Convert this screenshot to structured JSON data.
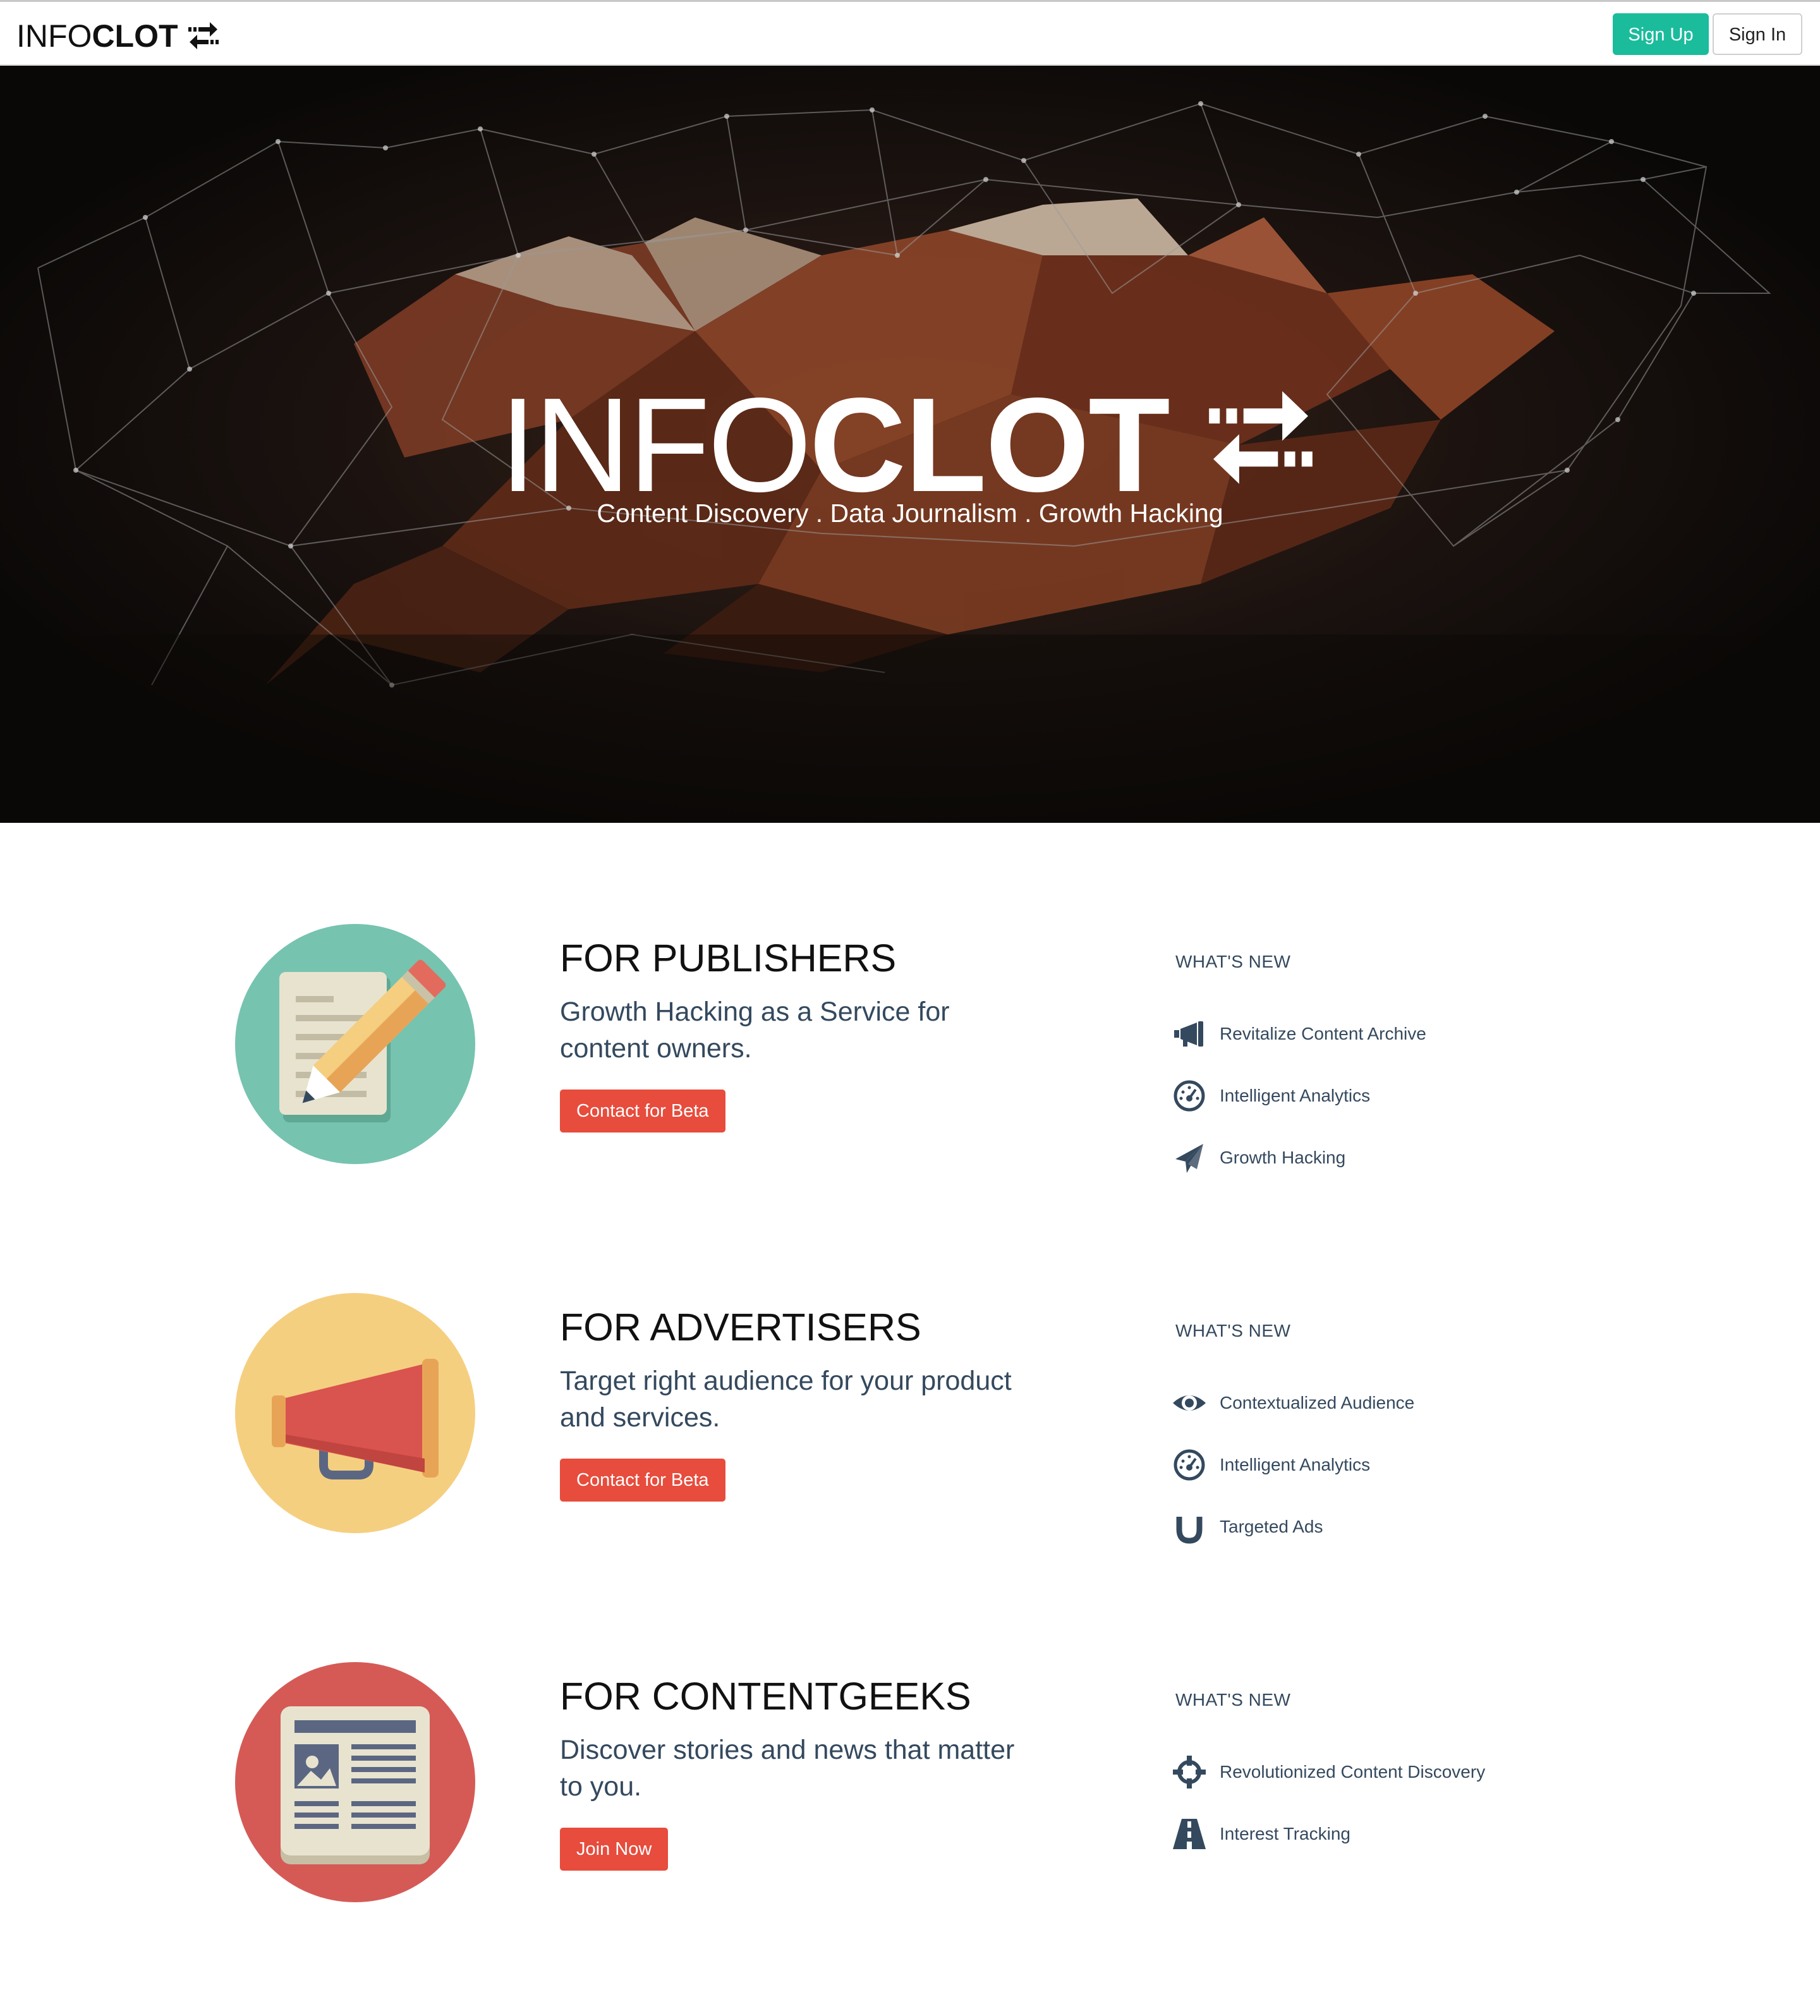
{
  "navbar": {
    "brand_light": "INFO",
    "brand_bold": "CLOT",
    "signup_label": "Sign Up",
    "signin_label": "Sign In"
  },
  "hero": {
    "title_light": "INFO",
    "title_bold": "CLOT",
    "tagline": "Content Discovery . Data Journalism . Growth Hacking"
  },
  "sections": [
    {
      "title": "FOR PUBLISHERS",
      "description": "Growth Hacking as a Service for content owners.",
      "button_label": "Contact for Beta",
      "whats_new_heading": "WHAT'S NEW",
      "items": [
        {
          "label": "Revitalize Content Archive",
          "icon": "megaphone-icon"
        },
        {
          "label": "Intelligent Analytics",
          "icon": "dashboard-icon"
        },
        {
          "label": "Growth Hacking",
          "icon": "paper-plane-icon"
        }
      ]
    },
    {
      "title": "FOR ADVERTISERS",
      "description": "Target right audience for your product and services.",
      "button_label": "Contact for Beta",
      "whats_new_heading": "WHAT'S NEW",
      "items": [
        {
          "label": "Contextualized Audience",
          "icon": "eye-icon"
        },
        {
          "label": "Intelligent Analytics",
          "icon": "dashboard-icon"
        },
        {
          "label": "Targeted Ads",
          "icon": "magnet-icon"
        }
      ]
    },
    {
      "title": "FOR CONTENTGEEKS",
      "description": "Discover stories and news that matter to you.",
      "button_label": "Join Now",
      "whats_new_heading": "WHAT'S NEW",
      "items": [
        {
          "label": "Revolutionized Content Discovery",
          "icon": "crosshair-icon"
        },
        {
          "label": "Interest Tracking",
          "icon": "road-icon"
        }
      ]
    }
  ],
  "colors": {
    "accent_green": "#1abc9c",
    "cta_red": "#e74c3c",
    "text_dark": "#34495e",
    "publishers_circle": "#76c3b0",
    "advertisers_circle": "#f5cf80",
    "geeks_circle": "#d55a56"
  }
}
